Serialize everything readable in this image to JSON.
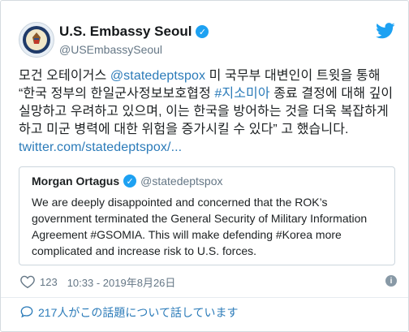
{
  "account": {
    "display_name": "U.S. Embassy Seoul",
    "handle": "@USEmbassySeoul"
  },
  "tweet": {
    "text_before": "모건 오테이거스 ",
    "mention": "@statedeptspox",
    "text_middle_1": " 미 국무부 대변인이 트윗을 통해 “한국 정부의 한일군사정보보호협정 ",
    "hashtag": "#지소미아",
    "text_middle_2": " 종료 결정에 대해 깊이 실망하고 우려하고 있으며, 이는 한국을 방어하는 것을 더욱 복잡하게 하고 미군 병력에 대한 위험을 증가시킬 수 있다” 고 했습니다. ",
    "link": "twitter.com/statedeptspox/..."
  },
  "quote": {
    "name": "Morgan Ortagus",
    "handle": "@statedeptspox",
    "text": "We are deeply disappointed and concerned that the ROK’s government terminated the General Security of Military Information Agreement #GSOMIA. This will make defending #Korea more complicated and increase risk to U.S. forces."
  },
  "meta": {
    "likes": "123",
    "timestamp": "10:33 - 2019年8月26日"
  },
  "footer": {
    "talking": "217人がこの話題について話しています"
  },
  "colors": {
    "link": "#2b7bb9",
    "verified": "#1da1f2",
    "muted": "#657786"
  },
  "icons": [
    "verified-icon",
    "twitter-bird-icon",
    "heart-icon",
    "info-icon",
    "speech-bubble-icon",
    "embassy-seal-icon"
  ]
}
